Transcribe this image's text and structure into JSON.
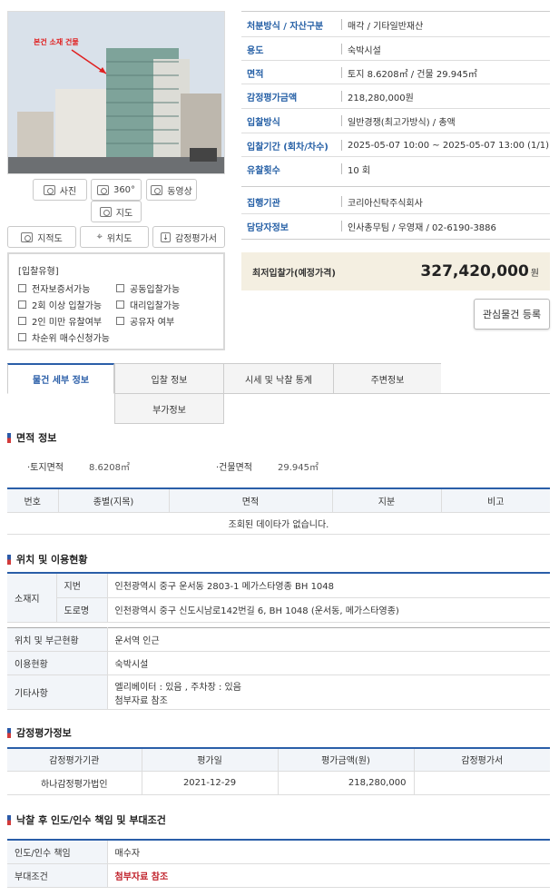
{
  "photo_caption": "본건 소재 건물",
  "media_buttons": [
    {
      "label": "사진",
      "icon": "camera-icon"
    },
    {
      "label": "360°",
      "icon": "camera-360-icon"
    },
    {
      "label": "동영상",
      "icon": "video-icon"
    },
    {
      "label": "지도",
      "icon": "map-icon"
    }
  ],
  "tool_buttons": [
    {
      "label": "지적도",
      "icon": "cadastral-map-icon"
    },
    {
      "label": "위치도",
      "icon": "location-pin-icon"
    },
    {
      "label": "감정평가서",
      "icon": "download-icon"
    }
  ],
  "bid_type": {
    "title": "[입찰유형]",
    "options": [
      "전자보증서가능",
      "공동입찰가능",
      "2회 이상 입찰가능",
      "대리입찰가능",
      "2인 미만 유찰여부",
      "공유자 여부",
      "차순위 매수신청가능"
    ]
  },
  "info": [
    {
      "k": "처분방식 / 자산구분",
      "v": "매각 / 기타일반재산"
    },
    {
      "k": "용도",
      "v": "숙박시설"
    },
    {
      "k": "면적",
      "v": "토지 8.6208㎡ / 건물 29.945㎡"
    },
    {
      "k": "감정평가금액",
      "v": "218,280,000원"
    },
    {
      "k": "입찰방식",
      "v": "일반경쟁(최고가방식) / 총액"
    },
    {
      "k": "입찰기간 (회차/차수)",
      "v": "2025-05-07 10:00 ~ 2025-05-07 13:00 (1/1)"
    },
    {
      "k": "유찰횟수",
      "v": "10 회"
    },
    {
      "k": "집행기관",
      "v": "코리아신탁주식회사"
    },
    {
      "k": "담당자정보",
      "v": "인사총무팀 / 우영재 / 02-6190-3886"
    }
  ],
  "price": {
    "label": "최저입찰가(예정가격)",
    "value": "327,420,000",
    "unit": "원"
  },
  "interest_button": "관심물건 등록",
  "tabs": [
    "물건 세부 정보",
    "입찰 정보",
    "시세 및 낙찰 통계",
    "주변정보",
    "부가정보"
  ],
  "area_section": {
    "title": "면적 정보",
    "land_label": "·토지면적",
    "land_value": "8.6208㎡",
    "bldg_label": "·건물면적",
    "bldg_value": "29.945㎡",
    "headers": [
      "번호",
      "종별(지목)",
      "면적",
      "지분",
      "비고"
    ],
    "empty": "조회된 데이타가 없습니다."
  },
  "location_section": {
    "title": "위치 및 이용현황",
    "addr_label": "소재지",
    "lot_label": "지번",
    "lot_value": "인천광역시 중구 운서동 2803-1 메가스타영종 BH 1048",
    "road_label": "도로명",
    "road_value": "인천광역시 중구 신도시남로142번길 6, BH 1048 (운서동, 메가스타영종)",
    "rows": [
      {
        "k": "위치 및 부근현황",
        "v": "운서역 인근"
      },
      {
        "k": "이용현황",
        "v": "숙박시설"
      }
    ],
    "etc_label": "기타사항",
    "etc_line1": "엘리베이터 : 있음 , 주차장 : 있음",
    "etc_line2": "첨부자료 참조"
  },
  "appraisal_section": {
    "title": "감정평가정보",
    "headers": [
      "감정평가기관",
      "평가일",
      "평가금액(원)",
      "감정평가서"
    ],
    "row": [
      "하나감정평가법인",
      "2021-12-29",
      "218,280,000",
      ""
    ]
  },
  "delivery_section": {
    "title": "낙찰 후 인도/인수 책임 및 부대조건",
    "resp_label": "인도/인수 책임",
    "resp_value": "매수자",
    "cond_label": "부대조건",
    "cond_value": "첨부자료 참조"
  },
  "colors": {
    "accent": "#2a5ea8",
    "label_blue": "#2660a6",
    "price_bg": "#f4efe1",
    "warn_red": "#c0212b"
  }
}
